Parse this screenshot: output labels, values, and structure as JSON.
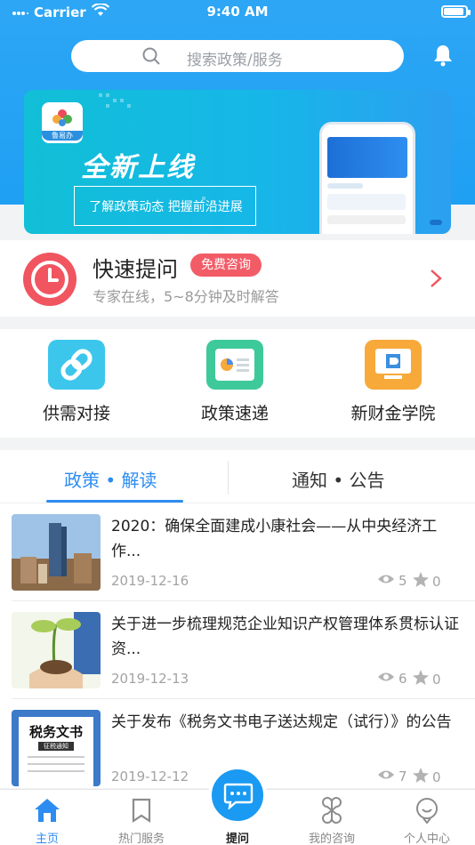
{
  "status_bar": {
    "carrier": "Carrier",
    "time": "9:40 AM",
    "battery_level": 1.0
  },
  "search": {
    "placeholder": "搜索政策/服务"
  },
  "banner": {
    "logo_text": "鲁易办",
    "title": "全新上线",
    "subtitle": "了解政策动态 把握前沿进展"
  },
  "quick_ask": {
    "title": "快速提问",
    "badge": "免费咨询",
    "description": "专家在线，5~8分钟及时解答"
  },
  "services": [
    {
      "label": "供需对接",
      "icon": "link-icon",
      "color": "#3cc6ec"
    },
    {
      "label": "政策速递",
      "icon": "report-card-icon",
      "color": "#3ec99a"
    },
    {
      "label": "新财金学院",
      "icon": "monitor-icon",
      "color": "#f7a93a"
    }
  ],
  "news_tabs": [
    {
      "label": "政策 • 解读",
      "active": true
    },
    {
      "label": "通知 • 公告",
      "active": false
    }
  ],
  "articles": [
    {
      "title": "2020：确保全面建成小康社会——从中央经济工作...",
      "date": "2019-12-16",
      "views": "5",
      "stars": "0",
      "thumb": "city-skyline-image"
    },
    {
      "title": "关于进一步梳理规范企业知识产权管理体系贯标认证资...",
      "date": "2019-12-13",
      "views": "6",
      "stars": "0",
      "thumb": "growing-money-plant-image"
    },
    {
      "title": "关于发布《税务文书电子送达规定（试行）》的公告",
      "date": "2019-12-12",
      "views": "7",
      "stars": "0",
      "thumb": "tax-document-image"
    }
  ],
  "thumb_texts": {
    "tax_doc": "税务文书",
    "tax_sub": "征税通知"
  },
  "tabbar": [
    {
      "label": "主页",
      "icon": "home-icon",
      "active": true
    },
    {
      "label": "热门服务",
      "icon": "bookmark-icon",
      "active": false
    },
    {
      "label": "提问",
      "icon": "chat-bubble-icon",
      "active": false
    },
    {
      "label": "我的咨询",
      "icon": "clover-icon",
      "active": false
    },
    {
      "label": "个人中心",
      "icon": "profile-icon",
      "active": false
    }
  ],
  "colors": {
    "primary": "#2d8cf0",
    "header": "#2da6f5",
    "badge": "#f25c67"
  }
}
